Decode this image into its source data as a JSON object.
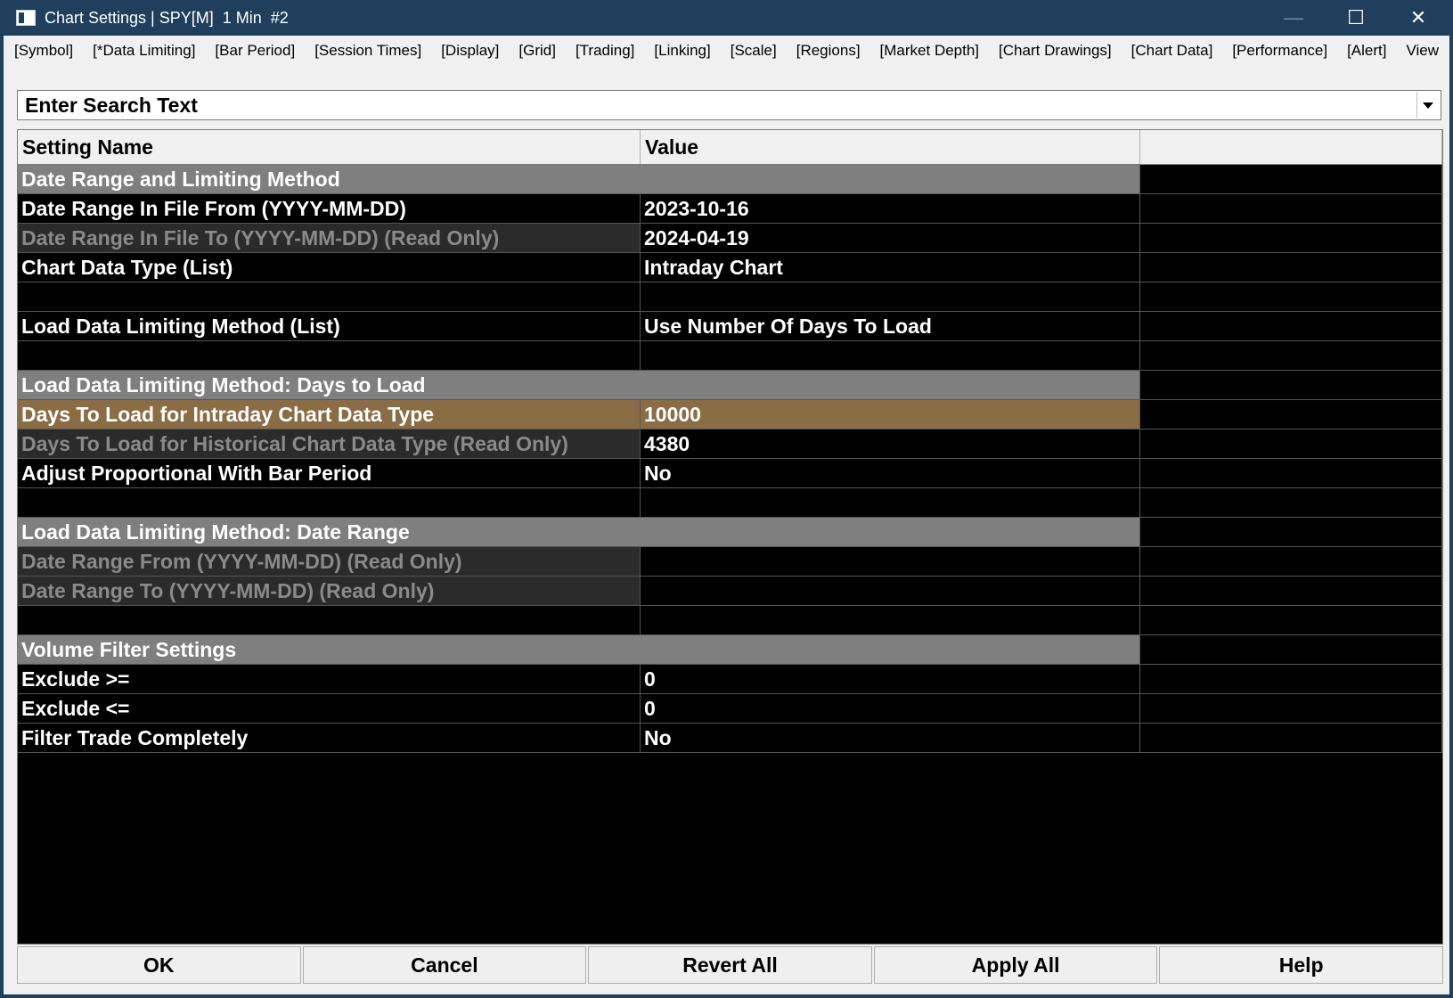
{
  "window": {
    "title": "Chart Settings | SPY[M]  1 Min  #2",
    "minimize_glyph": "—",
    "maximize_glyph": "☐",
    "close_glyph": "✕"
  },
  "menu": [
    "[Symbol]",
    "[*Data Limiting]",
    "[Bar Period]",
    "[Session Times]",
    "[Display]",
    "[Grid]",
    "[Trading]",
    "[Linking]",
    "[Scale]",
    "[Regions]",
    "[Market Depth]",
    "[Chart Drawings]",
    "[Chart Data]",
    "[Performance]",
    "[Alert]",
    "View"
  ],
  "search": {
    "placeholder": "Enter Search Text"
  },
  "grid": {
    "headers": {
      "name": "Setting Name",
      "value": "Value",
      "extra": ""
    },
    "rows": [
      {
        "type": "section",
        "name": "Date Range and Limiting Method"
      },
      {
        "type": "normal",
        "name": "Date Range In File From (YYYY-MM-DD)",
        "value": "2023-10-16"
      },
      {
        "type": "readonly",
        "name": "Date Range In File To (YYYY-MM-DD) (Read Only)",
        "value": "2024-04-19"
      },
      {
        "type": "normal",
        "name": "Chart Data Type (List)",
        "value": "Intraday Chart"
      },
      {
        "type": "blank",
        "name": "",
        "value": ""
      },
      {
        "type": "normal",
        "name": "Load Data Limiting Method (List)",
        "value": "Use Number Of Days To Load"
      },
      {
        "type": "blank",
        "name": "",
        "value": ""
      },
      {
        "type": "section",
        "name": "Load Data Limiting Method: Days to Load"
      },
      {
        "type": "selected",
        "name": "Days To Load for Intraday Chart Data Type",
        "value": "10000"
      },
      {
        "type": "readonly",
        "name": "Days To Load for Historical Chart Data Type (Read Only)",
        "value": "4380"
      },
      {
        "type": "normal",
        "name": "Adjust Proportional With Bar Period",
        "value": "No"
      },
      {
        "type": "blank",
        "name": "",
        "value": ""
      },
      {
        "type": "section",
        "name": "Load Data Limiting Method: Date Range"
      },
      {
        "type": "readonly",
        "name": "Date Range From (YYYY-MM-DD) (Read Only)",
        "value": ""
      },
      {
        "type": "readonly",
        "name": "Date Range To (YYYY-MM-DD) (Read Only)",
        "value": ""
      },
      {
        "type": "blank",
        "name": "",
        "value": ""
      },
      {
        "type": "section",
        "name": "Volume Filter Settings"
      },
      {
        "type": "normal",
        "name": "Exclude >=",
        "value": "0"
      },
      {
        "type": "normal",
        "name": "Exclude <=",
        "value": "0"
      },
      {
        "type": "normal",
        "name": "Filter Trade Completely",
        "value": "No"
      }
    ]
  },
  "buttons": {
    "ok": "OK",
    "cancel": "Cancel",
    "revert_all": "Revert All",
    "apply_all": "Apply All",
    "help": "Help"
  },
  "colors": {
    "titlebar": "#1f3f5c",
    "section_bg": "#7f7f7f",
    "selected_bg": "#8a6d45",
    "readonly_bg": "#2b2b2b",
    "readonly_text": "#8a8a8a",
    "grid_bg": "#000000"
  }
}
